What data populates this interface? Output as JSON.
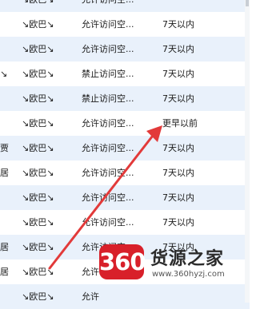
{
  "rows": [
    {
      "name": "",
      "owner": "↘欧巴↘",
      "permission": "允许访问空...",
      "time": ""
    },
    {
      "name": "",
      "owner": "↘欧巴↘",
      "permission": "允许访问空...",
      "time": "7天以内"
    },
    {
      "name": "",
      "owner": "↘欧巴↘",
      "permission": "允许访问空...",
      "time": "7天以内"
    },
    {
      "name": "↘",
      "owner": "↘欧巴↘",
      "permission": "禁止访问空...",
      "time": "7天以内"
    },
    {
      "name": "",
      "owner": "↘欧巴↘",
      "permission": "禁止访问空...",
      "time": "7天以内"
    },
    {
      "name": "",
      "owner": "↘欧巴↘",
      "permission": "允许访问空...",
      "time": "更早以前"
    },
    {
      "name": "贾",
      "owner": "↘欧巴↘",
      "permission": "允许访问空...",
      "time": "7天以内"
    },
    {
      "name": "居",
      "owner": "↘欧巴↘",
      "permission": "允许访问空...",
      "time": "7天以内"
    },
    {
      "name": "",
      "owner": "↘欧巴↘",
      "permission": "允许访问空...",
      "time": "7天以内"
    },
    {
      "name": "",
      "owner": "↘欧巴↘",
      "permission": "允许访问空...",
      "time": "7天以内"
    },
    {
      "name": "居",
      "owner": "↘欧巴↘",
      "permission": "允许访问空...",
      "time": "7天以内"
    },
    {
      "name": "居",
      "owner": "↘欧巴↘",
      "permission": "允许",
      "time": ""
    },
    {
      "name": "",
      "owner": "↘欧巴↘",
      "permission": "允许",
      "time": ""
    }
  ],
  "watermark": {
    "badge": "360",
    "title": "货源之家",
    "url": "www.360hyzj.com"
  },
  "colors": {
    "row_alt": "#e9f1fb",
    "arrow": "#e23a3a",
    "badge": "#d8202a"
  }
}
